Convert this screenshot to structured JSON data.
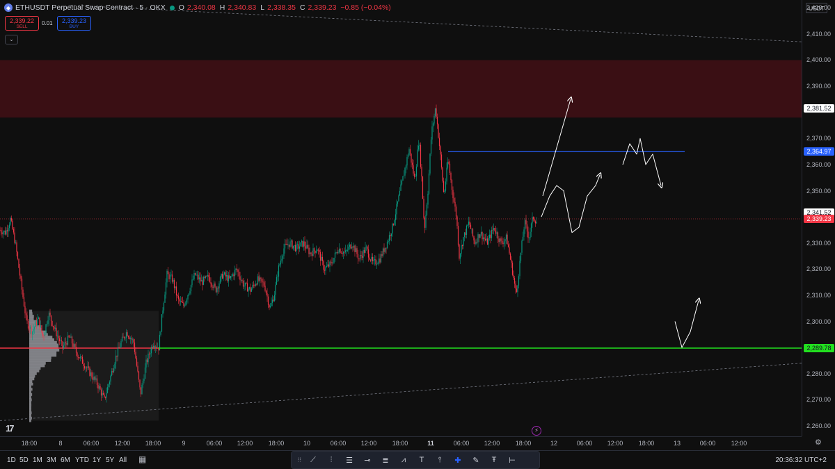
{
  "legend": {
    "symbol_icon": "ethereum-icon",
    "title": "ETHUSDT Perpetual Swap Contract · 5 · OKX",
    "open_key": "O",
    "open": "2,340.08",
    "high_key": "H",
    "high": "2,340.83",
    "low_key": "L",
    "low": "2,338.35",
    "close_key": "C",
    "close": "2,339.23",
    "change": "−0.85 (−0.04%)"
  },
  "trade": {
    "sell_price": "2,339.22",
    "sell_label": "SELL",
    "spread": "0.01",
    "buy_price": "2,339.23",
    "buy_label": "BUY",
    "collapse": "⌄"
  },
  "price_scale": {
    "currency": "USDT",
    "ticks": [
      "2,420.00",
      "2,410.00",
      "2,400.00",
      "2,390.00",
      "2,370.00",
      "2,360.00",
      "2,350.00",
      "2,330.00",
      "2,320.00",
      "2,310.00",
      "2,300.00",
      "2,280.00",
      "2,270.00",
      "2,260.00"
    ],
    "tick_values": [
      2420,
      2410,
      2400,
      2390,
      2370,
      2360,
      2350,
      2330,
      2320,
      2310,
      2300,
      2280,
      2270,
      2260
    ],
    "badges": [
      {
        "label": "2,381.52",
        "value": 2381.52,
        "bg": "#ffffff",
        "color": "#131722"
      },
      {
        "label": "2,364.97",
        "value": 2364.97,
        "bg": "#2962ff",
        "color": "#ffffff"
      },
      {
        "label": "2,341.52",
        "value": 2341.52,
        "bg": "#ffffff",
        "color": "#131722"
      },
      {
        "label": "2,339.23",
        "value": 2339.23,
        "bg": "#f23645",
        "color": "#ffffff"
      },
      {
        "label": "2,289.78",
        "value": 2289.78,
        "bg": "#22e01f",
        "color": "#131722"
      }
    ]
  },
  "time_axis": {
    "ticks": [
      {
        "label": "18:00",
        "bold": false
      },
      {
        "label": "8",
        "bold": false
      },
      {
        "label": "06:00",
        "bold": false
      },
      {
        "label": "12:00",
        "bold": false
      },
      {
        "label": "18:00",
        "bold": false
      },
      {
        "label": "9",
        "bold": false
      },
      {
        "label": "06:00",
        "bold": false
      },
      {
        "label": "12:00",
        "bold": false
      },
      {
        "label": "18:00",
        "bold": false
      },
      {
        "label": "10",
        "bold": false
      },
      {
        "label": "06:00",
        "bold": false
      },
      {
        "label": "12:00",
        "bold": false
      },
      {
        "label": "18:00",
        "bold": false
      },
      {
        "label": "11",
        "bold": true
      },
      {
        "label": "06:00",
        "bold": false
      },
      {
        "label": "12:00",
        "bold": false
      },
      {
        "label": "18:00",
        "bold": false
      },
      {
        "label": "12",
        "bold": false
      },
      {
        "label": "06:00",
        "bold": false
      },
      {
        "label": "12:00",
        "bold": false
      },
      {
        "label": "18:00",
        "bold": false
      },
      {
        "label": "13",
        "bold": false
      },
      {
        "label": "06:00",
        "bold": false
      },
      {
        "label": "12:00",
        "bold": false
      }
    ]
  },
  "ranges": [
    "1D",
    "5D",
    "1M",
    "3M",
    "6M",
    "YTD",
    "1Y",
    "5Y",
    "All"
  ],
  "clock": "20:36:32 UTC+2",
  "tools": [
    {
      "name": "grip-handle-icon",
      "glyph": "⁝⁝"
    },
    {
      "name": "trend-line-icon",
      "glyph": "⟋"
    },
    {
      "name": "pitchfork-icon",
      "glyph": "⫶"
    },
    {
      "name": "fib-retracement-icon",
      "glyph": "☰"
    },
    {
      "name": "horizontal-ray-icon",
      "glyph": "⊸"
    },
    {
      "name": "fib-levels-icon",
      "glyph": "≣"
    },
    {
      "name": "elliott-wave-icon",
      "glyph": "⩘"
    },
    {
      "name": "text-tool-icon",
      "glyph": "T"
    },
    {
      "name": "long-position-icon",
      "glyph": "⫯"
    },
    {
      "name": "crosshair-icon",
      "glyph": "✚"
    },
    {
      "name": "brush-icon",
      "glyph": "✎"
    },
    {
      "name": "anchored-text-icon",
      "glyph": "Ŧ"
    },
    {
      "name": "horizontal-line-icon",
      "glyph": "⊢"
    }
  ],
  "colors": {
    "bg": "#0f0f0f",
    "up": "#089981",
    "down": "#f23645",
    "supply_zone": "#3a0f14",
    "blue_level": "#2962ff",
    "green_level": "#22e01f",
    "profile": "#d1d4dc"
  },
  "chart_data": {
    "type": "candlestick",
    "title": "ETHUSDT Perpetual Swap Contract · 5 · OKX",
    "ylim": [
      2256,
      2423
    ],
    "x_ticks": [
      "18:00",
      "8",
      "06:00",
      "12:00",
      "18:00",
      "9",
      "06:00",
      "12:00",
      "18:00",
      "10",
      "06:00",
      "12:00",
      "18:00",
      "11",
      "06:00",
      "12:00",
      "18:00",
      "12",
      "06:00",
      "12:00",
      "18:00",
      "13",
      "06:00",
      "12:00"
    ],
    "supply_zone": [
      2378,
      2400
    ],
    "levels": [
      {
        "label": "2,364.97",
        "value": 2364.97,
        "color": "#2962ff"
      },
      {
        "label": "2,289.78",
        "value": 2289.78,
        "color": "#22e01f"
      },
      {
        "label": "2,339.23",
        "value": 2339.23,
        "color": "#f23645",
        "style": "dotted"
      }
    ],
    "price_path": [
      [
        0,
        2335
      ],
      [
        8,
        2334
      ],
      [
        15,
        2339
      ],
      [
        22,
        2330
      ],
      [
        30,
        2315
      ],
      [
        38,
        2300
      ],
      [
        46,
        2296
      ],
      [
        55,
        2301
      ],
      [
        62,
        2294
      ],
      [
        70,
        2303
      ],
      [
        80,
        2296
      ],
      [
        90,
        2290
      ],
      [
        100,
        2294
      ],
      [
        110,
        2288
      ],
      [
        120,
        2284
      ],
      [
        130,
        2280
      ],
      [
        140,
        2276
      ],
      [
        150,
        2270
      ],
      [
        158,
        2278
      ],
      [
        166,
        2286
      ],
      [
        174,
        2292
      ],
      [
        182,
        2296
      ],
      [
        192,
        2292
      ],
      [
        202,
        2272
      ],
      [
        210,
        2284
      ],
      [
        220,
        2292
      ],
      [
        228,
        2290
      ],
      [
        234,
        2305
      ],
      [
        240,
        2318
      ],
      [
        248,
        2316
      ],
      [
        256,
        2308
      ],
      [
        264,
        2306
      ],
      [
        272,
        2312
      ],
      [
        280,
        2318
      ],
      [
        290,
        2315
      ],
      [
        300,
        2317
      ],
      [
        310,
        2312
      ],
      [
        320,
        2318
      ],
      [
        330,
        2316
      ],
      [
        340,
        2320
      ],
      [
        350,
        2314
      ],
      [
        360,
        2312
      ],
      [
        370,
        2316
      ],
      [
        380,
        2314
      ],
      [
        388,
        2305
      ],
      [
        394,
        2310
      ],
      [
        400,
        2320
      ],
      [
        408,
        2328
      ],
      [
        416,
        2330
      ],
      [
        426,
        2328
      ],
      [
        436,
        2330
      ],
      [
        446,
        2326
      ],
      [
        456,
        2328
      ],
      [
        466,
        2320
      ],
      [
        476,
        2322
      ],
      [
        486,
        2328
      ],
      [
        496,
        2326
      ],
      [
        506,
        2330
      ],
      [
        516,
        2324
      ],
      [
        526,
        2328
      ],
      [
        536,
        2322
      ],
      [
        546,
        2324
      ],
      [
        556,
        2330
      ],
      [
        564,
        2336
      ],
      [
        572,
        2346
      ],
      [
        580,
        2356
      ],
      [
        588,
        2366
      ],
      [
        596,
        2354
      ],
      [
        602,
        2370
      ],
      [
        606,
        2355
      ],
      [
        610,
        2335
      ],
      [
        615,
        2350
      ],
      [
        620,
        2372
      ],
      [
        626,
        2382
      ],
      [
        632,
        2366
      ],
      [
        638,
        2348
      ],
      [
        644,
        2362
      ],
      [
        650,
        2350
      ],
      [
        656,
        2340
      ],
      [
        660,
        2325
      ],
      [
        666,
        2332
      ],
      [
        674,
        2338
      ],
      [
        682,
        2330
      ],
      [
        690,
        2334
      ],
      [
        700,
        2330
      ],
      [
        710,
        2336
      ],
      [
        720,
        2330
      ],
      [
        728,
        2332
      ],
      [
        736,
        2320
      ],
      [
        742,
        2310
      ],
      [
        748,
        2325
      ],
      [
        754,
        2338
      ],
      [
        760,
        2332
      ],
      [
        766,
        2340
      ],
      [
        772,
        2338
      ]
    ],
    "volume_profile": {
      "poc": 2289.78,
      "range": [
        2262,
        2304
      ]
    },
    "trend_lines": [
      {
        "from": [
          100,
          2421
        ],
        "to": [
          1152,
          2407
        ]
      },
      {
        "from": [
          0,
          2262
        ],
        "to": [
          1152,
          2284
        ]
      }
    ],
    "projections": [
      {
        "type": "arrow",
        "points": [
          [
            780,
            2348
          ],
          [
            820,
            2385
          ]
        ]
      },
      {
        "type": "path",
        "points": [
          [
            778,
            2340
          ],
          [
            790,
            2348
          ],
          [
            800,
            2352
          ],
          [
            810,
            2350
          ],
          [
            822,
            2334
          ],
          [
            832,
            2336
          ],
          [
            844,
            2348
          ],
          [
            856,
            2352
          ],
          [
            862,
            2356
          ]
        ]
      },
      {
        "type": "path",
        "points": [
          [
            895,
            2360
          ],
          [
            905,
            2368
          ],
          [
            915,
            2364
          ],
          [
            920,
            2370
          ],
          [
            928,
            2360
          ],
          [
            938,
            2364
          ],
          [
            950,
            2352
          ]
        ]
      },
      {
        "type": "path",
        "points": [
          [
            970,
            2300
          ],
          [
            980,
            2290
          ],
          [
            992,
            2296
          ],
          [
            1004,
            2308
          ]
        ]
      }
    ]
  }
}
